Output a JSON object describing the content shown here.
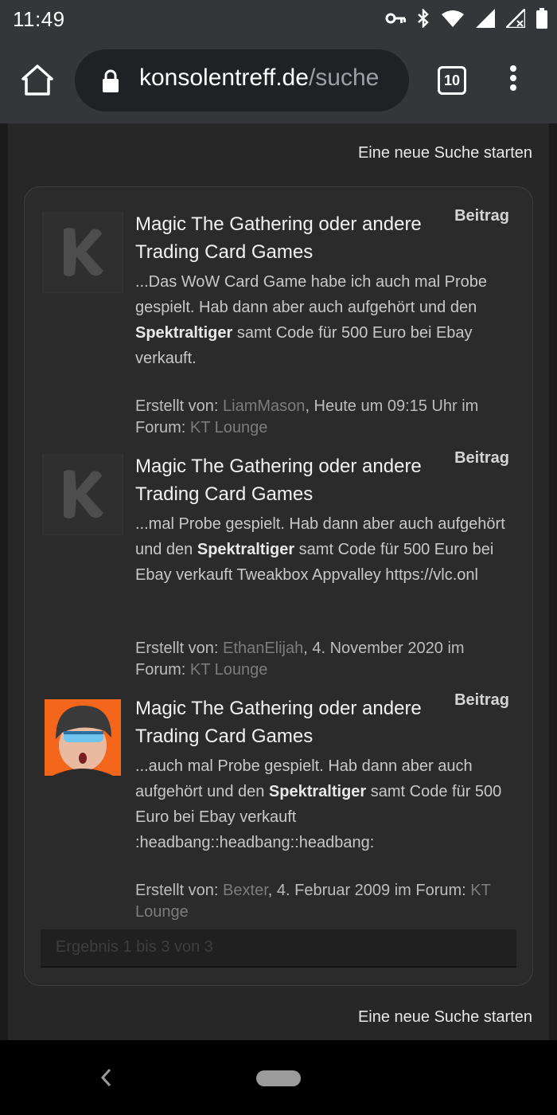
{
  "status": {
    "time": "11:49"
  },
  "browser": {
    "url_domain": "konsolentreff.de",
    "url_path": "/suche",
    "tab_count": "10"
  },
  "page": {
    "new_search_top": "Eine neue Suche starten",
    "new_search_bottom": "Eine neue Suche starten",
    "pager_text": "Ergebnis 1 bis 3 von 3",
    "results": [
      {
        "title": "Magic The Gathering oder andere Trading Card Games",
        "type": "Beitrag",
        "snippet_pre": "...Das WoW Card Game habe ich auch mal Probe gespielt. Hab dann aber auch aufgehört und den ",
        "snippet_bold": "Spektraltiger",
        "snippet_post": " samt Code für 500 Euro bei Ebay verkauft.",
        "meta_prefix": "Erstellt von: ",
        "author": "LiamMason",
        "meta_date": ", Heute um 09:15 Uhr im Forum: ",
        "forum": "KT Lounge",
        "avatar": "k-logo"
      },
      {
        "title": "Magic The Gathering oder andere Trading Card Games",
        "type": "Beitrag",
        "snippet_pre": "...mal Probe gespielt. Hab dann aber auch aufgehört und den ",
        "snippet_bold": "Spektraltiger",
        "snippet_post": " samt Code für 500 Euro bei Ebay verkauft Tweakbox Appvalley https://vlc.onl",
        "meta_prefix": "Erstellt von: ",
        "author": "EthanElijah",
        "meta_date": ", 4. November 2020 im Forum: ",
        "forum": "KT Lounge",
        "avatar": "k-logo"
      },
      {
        "title": "Magic The Gathering oder andere Trading Card Games",
        "type": "Beitrag",
        "snippet_pre": "...auch mal Probe gespielt. Hab dann aber auch aufgehört und den ",
        "snippet_bold": "Spektraltiger",
        "snippet_post": " samt Code für 500 Euro bei Ebay verkauft :headbang::headbang::headbang:",
        "meta_prefix": "Erstellt von: ",
        "author": "Bexter",
        "meta_date": ", 4. Februar 2009 im Forum: ",
        "forum": "KT Lounge",
        "avatar": "user-photo"
      }
    ]
  },
  "colors": {
    "chrome_bar": "#35363a",
    "page_bg": "#272727",
    "link_muted": "#7c7c7c",
    "avatar_orange": "#f4661b"
  }
}
